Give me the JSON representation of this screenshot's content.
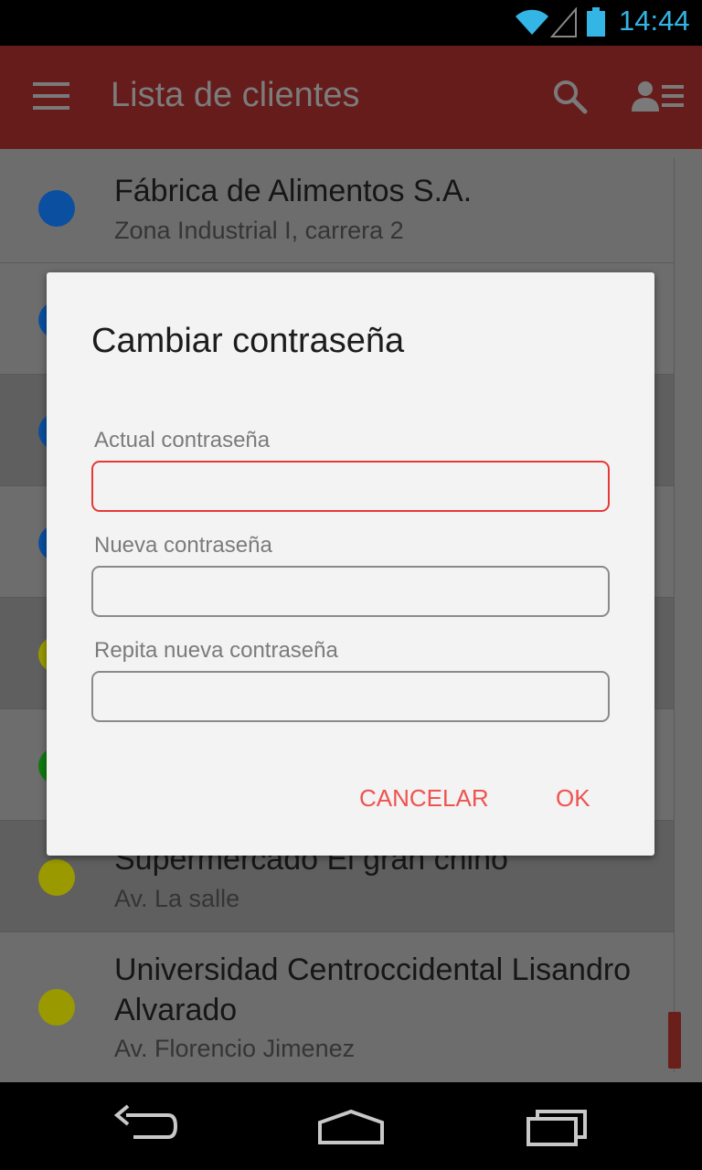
{
  "status_bar": {
    "time": "14:44",
    "icons": [
      "wifi-icon",
      "signal-icon",
      "battery-icon"
    ],
    "accent_color": "#33b5e5"
  },
  "app_bar": {
    "title": "Lista de clientes",
    "background": "#661c1a",
    "icons": [
      "menu-icon",
      "search-icon",
      "contacts-icon"
    ]
  },
  "clients": [
    {
      "name": "Fábrica de Alimentos S.A.",
      "address": "Zona Industrial I, carrera 2",
      "color": "#0a4fa0"
    },
    {
      "name": "",
      "address": "",
      "color": "#0a4fa0"
    },
    {
      "name": "",
      "address": "",
      "color": "#0a4fa0"
    },
    {
      "name": "",
      "address": "",
      "color": "#0a4fa0"
    },
    {
      "name": "",
      "address": "",
      "color": "#9a9a00"
    },
    {
      "name": "",
      "address": "",
      "color": "#107a10"
    },
    {
      "name": "Supermercado El gran chino",
      "address": "Av. La salle",
      "color": "#9a9a00"
    },
    {
      "name": "Universidad Centroccidental Lisandro Alvarado",
      "address": "Av. Florencio Jimenez",
      "color": "#9a9a00"
    }
  ],
  "dialog": {
    "title": "Cambiar contraseña",
    "fields": [
      {
        "label": "Actual contraseña",
        "value": ""
      },
      {
        "label": "Nueva contraseña",
        "value": ""
      },
      {
        "label": "Repita nueva contraseña",
        "value": ""
      }
    ],
    "cancel_label": "CANCELAR",
    "ok_label": "OK",
    "accent_color": "#ef5350"
  },
  "nav_bar": {
    "icons": [
      "back-icon",
      "home-icon",
      "recents-icon"
    ]
  }
}
